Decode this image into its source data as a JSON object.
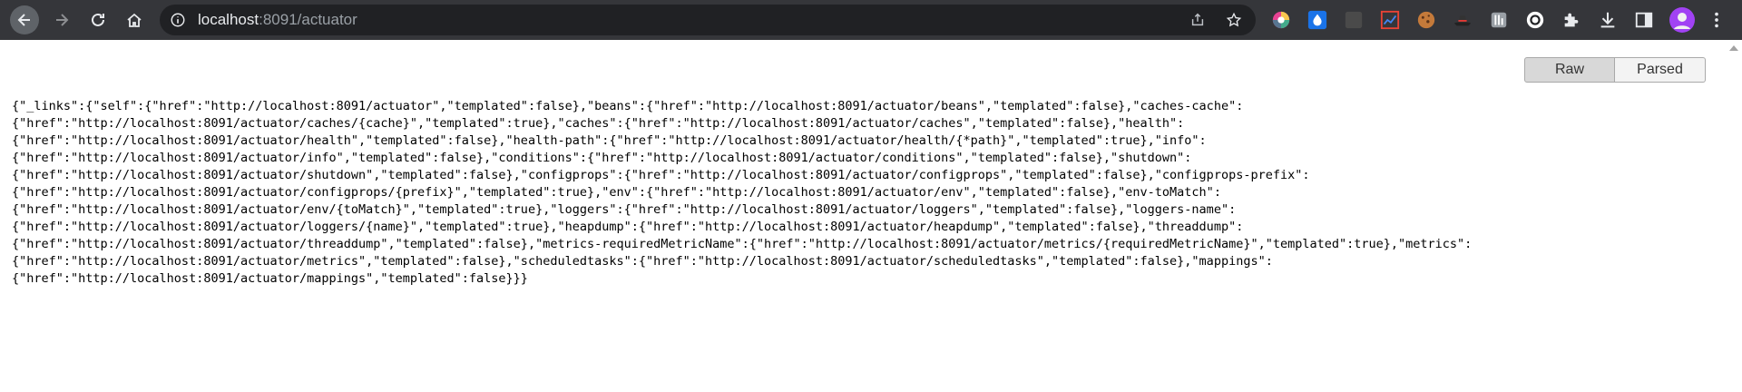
{
  "browser": {
    "url_host": "localhost",
    "url_rest": ":8091/actuator",
    "icons": {
      "back": "arrow-left-icon",
      "forward": "arrow-right-icon",
      "reload": "reload-icon",
      "home": "home-icon",
      "info": "info-icon",
      "share": "share-icon",
      "bookmark": "star-icon",
      "extensions": [
        "color-wheel-icon",
        "water-drop-icon",
        "dark-square-icon",
        "chart-icon",
        "cookie-icon",
        "hat-icon",
        "tag-icon",
        "circle-logo-icon",
        "puzzle-icon",
        "download-icon",
        "sidebar-icon",
        "avatar-icon",
        "kebab-menu-icon"
      ]
    }
  },
  "viewer": {
    "raw_label": "Raw",
    "parsed_label": "Parsed"
  },
  "content": {
    "json_text": "{\"_links\":{\"self\":{\"href\":\"http://localhost:8091/actuator\",\"templated\":false},\"beans\":{\"href\":\"http://localhost:8091/actuator/beans\",\"templated\":false},\"caches-cache\":\n{\"href\":\"http://localhost:8091/actuator/caches/{cache}\",\"templated\":true},\"caches\":{\"href\":\"http://localhost:8091/actuator/caches\",\"templated\":false},\"health\":\n{\"href\":\"http://localhost:8091/actuator/health\",\"templated\":false},\"health-path\":{\"href\":\"http://localhost:8091/actuator/health/{*path}\",\"templated\":true},\"info\":\n{\"href\":\"http://localhost:8091/actuator/info\",\"templated\":false},\"conditions\":{\"href\":\"http://localhost:8091/actuator/conditions\",\"templated\":false},\"shutdown\":\n{\"href\":\"http://localhost:8091/actuator/shutdown\",\"templated\":false},\"configprops\":{\"href\":\"http://localhost:8091/actuator/configprops\",\"templated\":false},\"configprops-prefix\":\n{\"href\":\"http://localhost:8091/actuator/configprops/{prefix}\",\"templated\":true},\"env\":{\"href\":\"http://localhost:8091/actuator/env\",\"templated\":false},\"env-toMatch\":\n{\"href\":\"http://localhost:8091/actuator/env/{toMatch}\",\"templated\":true},\"loggers\":{\"href\":\"http://localhost:8091/actuator/loggers\",\"templated\":false},\"loggers-name\":\n{\"href\":\"http://localhost:8091/actuator/loggers/{name}\",\"templated\":true},\"heapdump\":{\"href\":\"http://localhost:8091/actuator/heapdump\",\"templated\":false},\"threaddump\":\n{\"href\":\"http://localhost:8091/actuator/threaddump\",\"templated\":false},\"metrics-requiredMetricName\":{\"href\":\"http://localhost:8091/actuator/metrics/{requiredMetricName}\",\"templated\":true},\"metrics\":\n{\"href\":\"http://localhost:8091/actuator/metrics\",\"templated\":false},\"scheduledtasks\":{\"href\":\"http://localhost:8091/actuator/scheduledtasks\",\"templated\":false},\"mappings\":\n{\"href\":\"http://localhost:8091/actuator/mappings\",\"templated\":false}}}"
  },
  "colors": {
    "toolbar_bg": "#35363a",
    "omnibox_bg": "#202124",
    "icon": "#e8eaed"
  }
}
